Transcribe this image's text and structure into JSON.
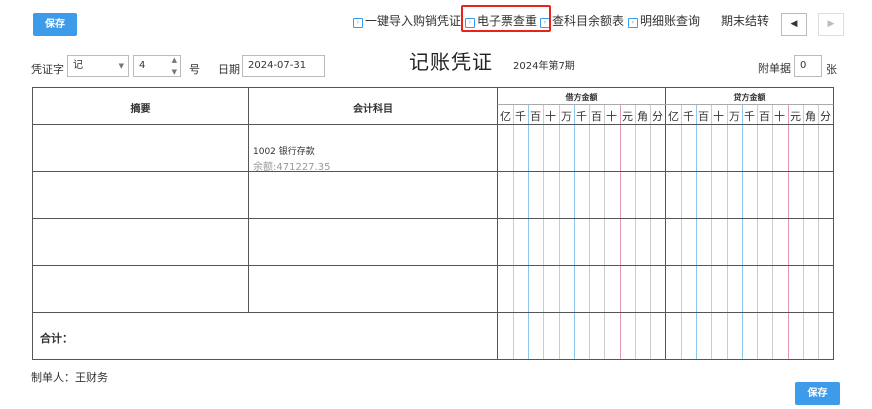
{
  "toolbar": {
    "save_label": "保存",
    "links": [
      "一键导入购销凭证",
      "电子票查重",
      "查科目余额表",
      "明细账查询",
      "期末结转"
    ],
    "prev_icon": "triangle-left-icon",
    "next_icon": "triangle-right-icon"
  },
  "form": {
    "voucher_word_label": "凭证字",
    "voucher_word_value": "记",
    "voucher_no_value": "4",
    "no_suffix": "号",
    "date_label": "日期",
    "date_value": "2024-07-31",
    "attachments_label": "附单据",
    "attachments_value": "0",
    "attachments_unit": "张"
  },
  "voucher": {
    "title": "记账凭证",
    "period": "2024年第7期"
  },
  "table": {
    "col_summary": "摘要",
    "col_account": "会计科目",
    "debit_header": "借方金额",
    "credit_header": "贷方金额",
    "digits": [
      "亿",
      "千",
      "百",
      "十",
      "万",
      "千",
      "百",
      "十",
      "元",
      "角",
      "分"
    ],
    "rows": [
      {
        "summary": "",
        "account": "1002 银行存款",
        "balance": "余额:471227.35"
      },
      {
        "summary": "",
        "account": "",
        "balance": ""
      },
      {
        "summary": "",
        "account": "",
        "balance": ""
      },
      {
        "summary": "",
        "account": "",
        "balance": ""
      }
    ],
    "total_label": "合计："
  },
  "footer": {
    "maker": "制单人：王财务",
    "save_label": "保存"
  }
}
